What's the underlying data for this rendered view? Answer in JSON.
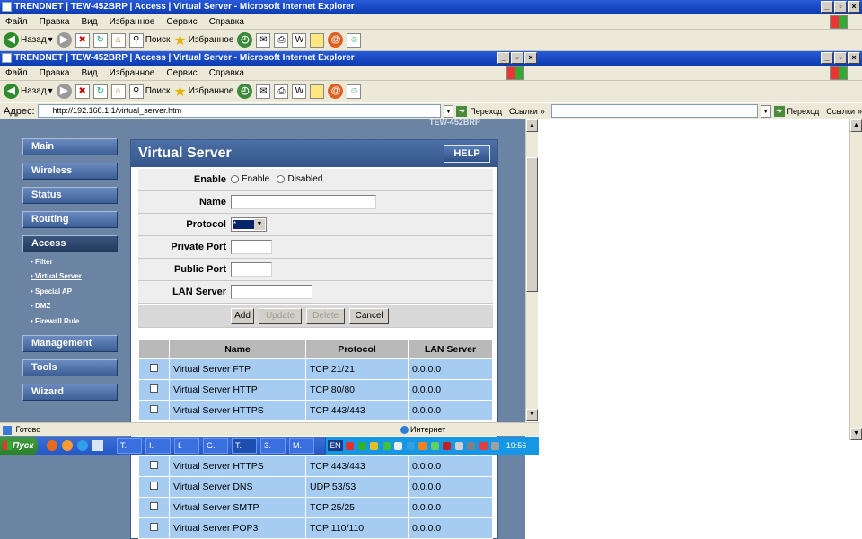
{
  "window_title": "TRENDNET | TEW-452BRP | Access | Virtual Server - Microsoft Internet Explorer",
  "menu": [
    "Файл",
    "Правка",
    "Вид",
    "Избранное",
    "Сервис",
    "Справка"
  ],
  "toolbar": {
    "back": "Назад",
    "search": "Поиск",
    "favorites": "Избранное"
  },
  "address": {
    "label": "Адрес:",
    "url": "http://192.168.1.1/virtual_server.htm",
    "go": "Переход",
    "links": "Ссылки"
  },
  "router": {
    "model_banner": "TEW-452BRP",
    "nav": [
      "Main",
      "Wireless",
      "Status",
      "Routing",
      "Access",
      "Management",
      "Tools",
      "Wizard"
    ],
    "subnav": [
      "Filter",
      "Virtual Server",
      "Special AP",
      "DMZ",
      "Firewall Rule"
    ],
    "panel_title": "Virtual Server",
    "help": "HELP",
    "form": {
      "enable_label": "Enable",
      "enable_opt": "Enable",
      "disable_opt": "Disabled",
      "name_label": "Name",
      "protocol_label": "Protocol",
      "protocol_value": "*",
      "private_port_label": "Private Port",
      "public_port_label": "Public Port",
      "lan_server_label": "LAN Server",
      "buttons": {
        "add": "Add",
        "update": "Update",
        "delete": "Delete",
        "cancel": "Cancel"
      }
    },
    "table": {
      "headers": [
        "Name",
        "Protocol",
        "LAN Server"
      ],
      "rows": [
        [
          "Virtual Server FTP",
          "TCP 21/21",
          "0.0.0.0"
        ],
        [
          "Virtual Server HTTP",
          "TCP 80/80",
          "0.0.0.0"
        ],
        [
          "Virtual Server HTTPS",
          "TCP 443/443",
          "0.0.0.0"
        ]
      ],
      "rows_lower": [
        [
          "Virtual Server HTTPS",
          "TCP 443/443",
          "0.0.0.0"
        ],
        [
          "Virtual Server DNS",
          "UDP 53/53",
          "0.0.0.0"
        ],
        [
          "Virtual Server SMTP",
          "TCP 25/25",
          "0.0.0.0"
        ],
        [
          "Virtual Server POP3",
          "TCP 110/110",
          "0.0.0.0"
        ]
      ]
    }
  },
  "status": {
    "done": "Готово",
    "zone": "Интернет"
  },
  "taskbar": {
    "start": "Пуск",
    "buttons": [
      "T.",
      "I.",
      "I.",
      "G.",
      "T.",
      "З.",
      "M."
    ],
    "lang": "EN",
    "clock": "19:56"
  }
}
